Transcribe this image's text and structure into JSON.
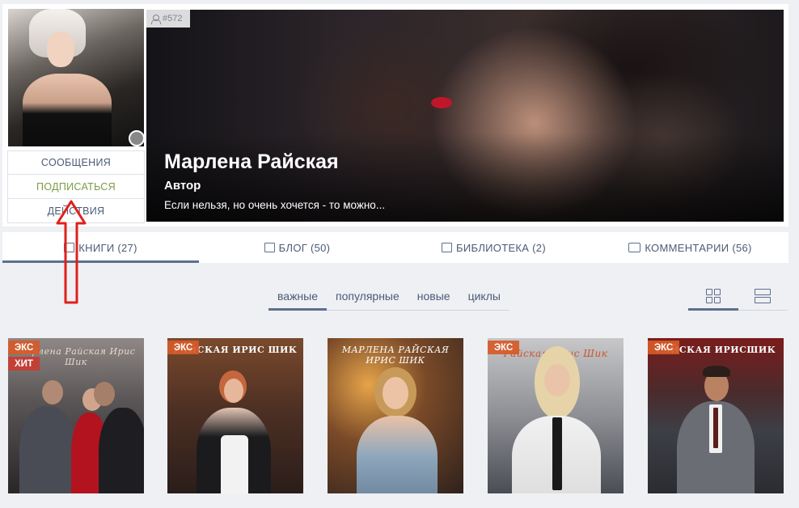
{
  "profile": {
    "badge_id": "#572",
    "name": "Марлена Райская",
    "role": "Автор",
    "motto": "Если нельзя, но очень хочется - то можно..."
  },
  "side_menu": {
    "messages": "СООБЩЕНИЯ",
    "subscribe": "ПОДПИСАТЬСЯ",
    "actions": "ДЕЙСТВИЯ"
  },
  "tabs": [
    {
      "label": "КНИГИ (27)",
      "icon": "book-icon",
      "active": true
    },
    {
      "label": "БЛОГ (50)",
      "icon": "blog-icon",
      "active": false
    },
    {
      "label": "БИБЛИОТЕКА (2)",
      "icon": "library-icon",
      "active": false
    },
    {
      "label": "КОММЕНТАРИИ (56)",
      "icon": "comments-icon",
      "active": false
    }
  ],
  "filters": [
    "важные",
    "популярные",
    "новые",
    "циклы"
  ],
  "active_filter": "важные",
  "views": [
    "grid-view-icon",
    "list-view-icon"
  ],
  "books": [
    {
      "labels": [
        "ЭКС",
        "ХИТ"
      ],
      "cover_text": "Марлена Райская   Ирис Шик"
    },
    {
      "labels": [
        "ЭКС"
      ],
      "cover_text": "РАЙСКАЯ  ИРИС ШИК"
    },
    {
      "labels": [],
      "cover_text": "МАРЛЕНА РАЙСКАЯ  ИРИС ШИК"
    },
    {
      "labels": [
        "ЭКС"
      ],
      "cover_text": "Райская   Ирис Шик"
    },
    {
      "labels": [
        "ЭКС"
      ],
      "cover_text": "РАЙСКАЯ  ИРИСШИК"
    }
  ],
  "colors": {
    "accent": "#5d6f8e",
    "subscribe": "#7d9b46",
    "annotation_arrow": "#e0201c",
    "label_exclusive": "#d65a28"
  }
}
